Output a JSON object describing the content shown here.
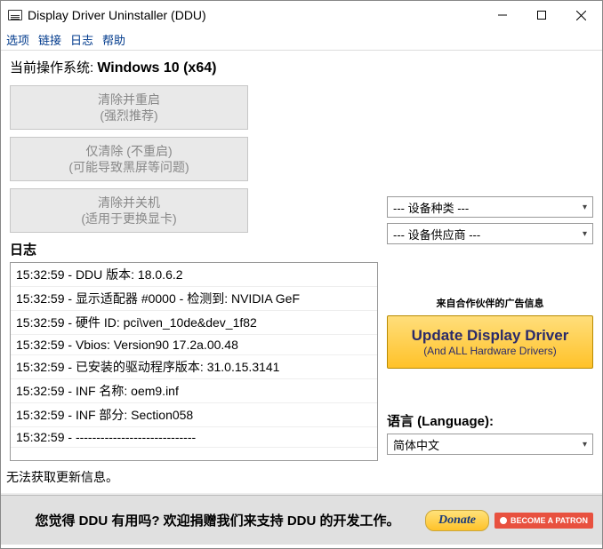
{
  "window": {
    "title": "Display Driver Uninstaller (DDU)"
  },
  "menu": {
    "options": "选项",
    "links": "链接",
    "log": "日志",
    "help": "帮助"
  },
  "os": {
    "label": "当前操作系统: ",
    "value": "Windows 10 (x64)"
  },
  "buttons": {
    "cleanRestart": {
      "l1": "清除并重启",
      "l2": "(强烈推荐)"
    },
    "cleanOnly": {
      "l1": "仅清除 (不重启)",
      "l2": "(可能导致黑屏等问题)"
    },
    "cleanShutdown": {
      "l1": "清除并关机",
      "l2": "(适用于更换显卡)"
    }
  },
  "log": {
    "header": "日志",
    "lines": [
      "15:32:59 - DDU 版本: 18.0.6.2",
      "15:32:59 - 显示适配器 #0000 - 检测到: NVIDIA GeF",
      "15:32:59 - 硬件 ID: pci\\ven_10de&dev_1f82",
      "15:32:59 - Vbios: Version90 17.2a.00.48",
      "15:32:59 - 已安装的驱动程序版本: 31.0.15.3141",
      "15:32:59 - INF 名称: oem9.inf",
      "15:32:59 - INF 部分: Section058",
      "15:32:59 - -----------------------------"
    ]
  },
  "selects": {
    "deviceType": "--- 设备种类 ---",
    "vendor": "--- 设备供应商 ---"
  },
  "partner": {
    "label": "来自合作伙伴的广告信息",
    "line1": "Update Display Driver",
    "line2": "(And ALL Hardware Drivers)"
  },
  "language": {
    "label": "语言 (Language):",
    "value": "简体中文"
  },
  "status": "无法获取更新信息。",
  "donate": {
    "msg": "您觉得 DDU 有用吗? 欢迎捐赠我们来支持 DDU 的开发工作。",
    "btn": "Donate",
    "patreon": "BECOME A PATRON"
  }
}
